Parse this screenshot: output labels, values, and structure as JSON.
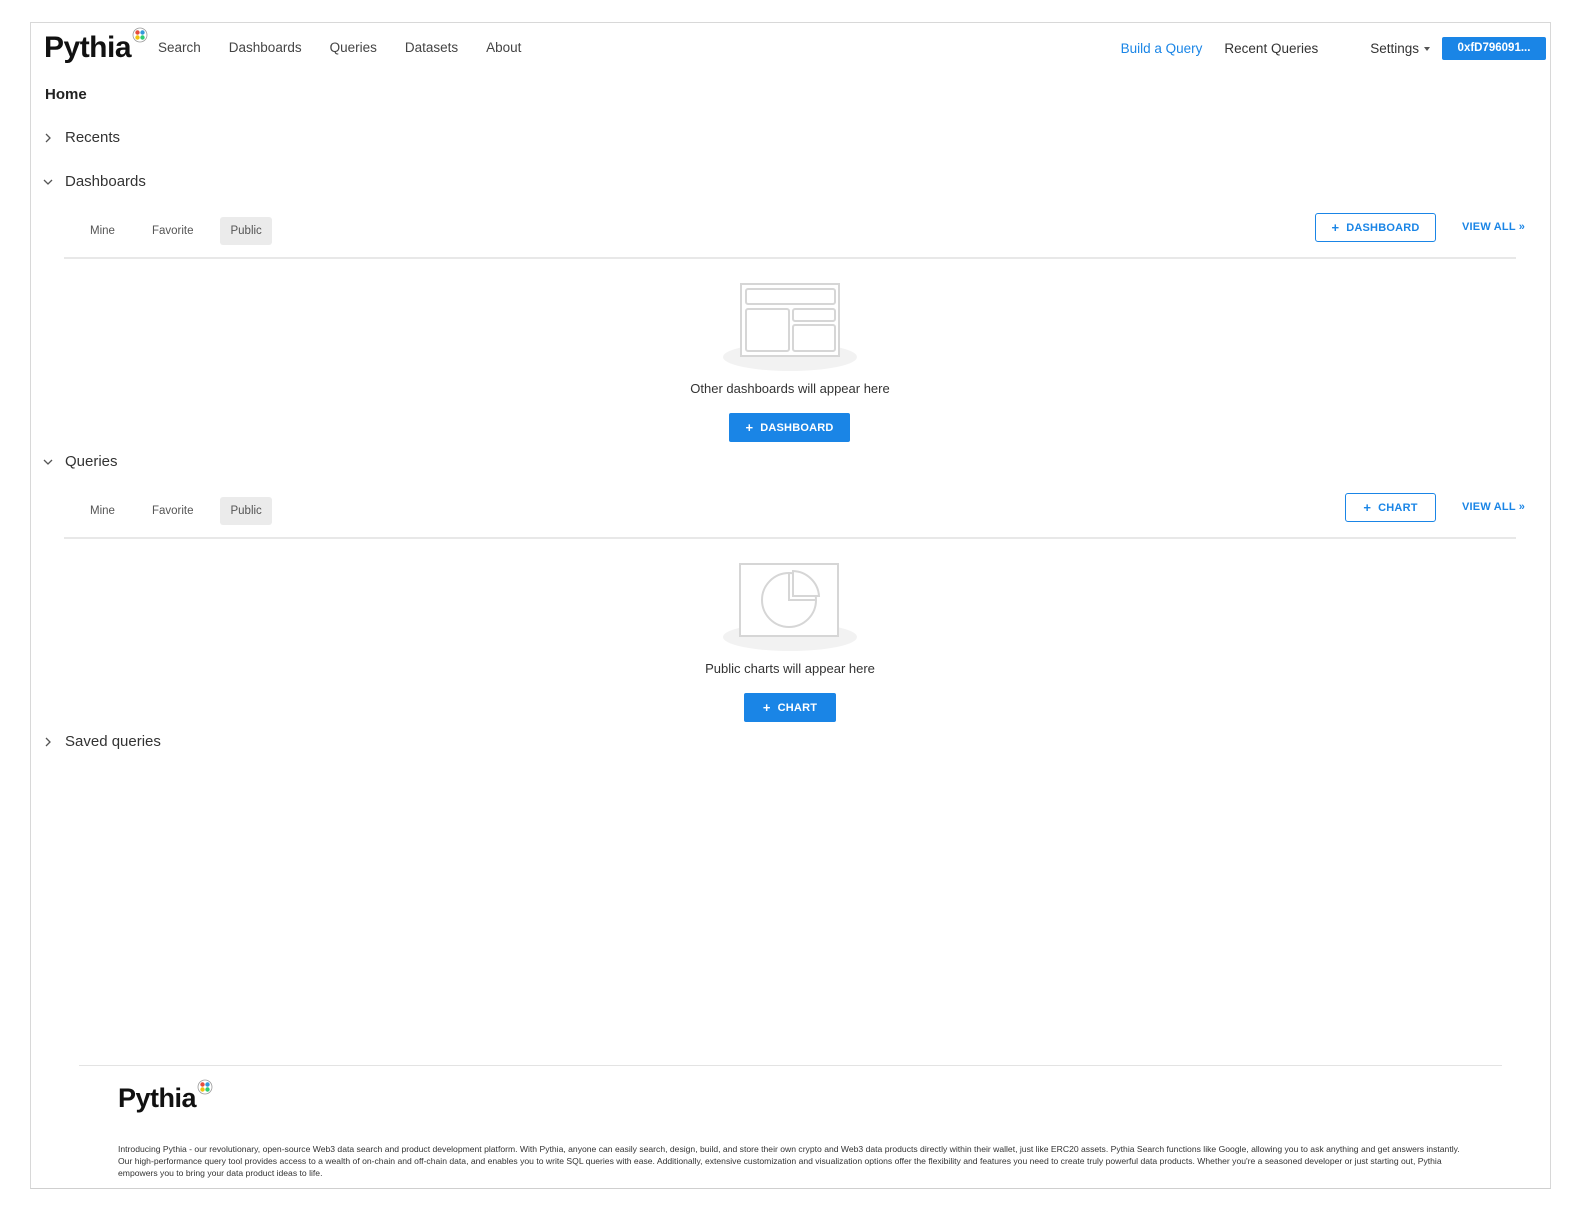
{
  "brand": {
    "name": "Pythia"
  },
  "nav": {
    "links": [
      "Search",
      "Dashboards",
      "Queries",
      "Datasets",
      "About"
    ],
    "build_query": "Build a Query",
    "recent_queries": "Recent Queries",
    "settings": "Settings",
    "wallet": "0xfD796091..."
  },
  "page": {
    "title": "Home"
  },
  "sections": {
    "recents": {
      "label": "Recents",
      "expanded": false
    },
    "dashboards": {
      "label": "Dashboards",
      "expanded": true,
      "tabs": [
        "Mine",
        "Favorite",
        "Public"
      ],
      "active_tab": "Public",
      "add_label": "DASHBOARD",
      "view_all": "VIEW ALL »",
      "empty_text": "Other dashboards will appear here",
      "empty_button": "DASHBOARD",
      "empty_icon": "dashboard-placeholder-icon"
    },
    "queries": {
      "label": "Queries",
      "expanded": true,
      "tabs": [
        "Mine",
        "Favorite",
        "Public"
      ],
      "active_tab": "Public",
      "add_label": "CHART",
      "view_all": "VIEW ALL »",
      "empty_text": "Public charts will appear here",
      "empty_button": "CHART",
      "empty_icon": "pie-chart-placeholder-icon"
    },
    "saved_queries": {
      "label": "Saved queries",
      "expanded": false
    }
  },
  "footer": {
    "brand": "Pythia",
    "description": "Introducing Pythia - our revolutionary, open-source Web3 data search and product development platform. With Pythia, anyone can easily search, design, build, and store their own crypto and Web3 data products directly within their wallet, just like ERC20 assets. Pythia Search functions like Google, allowing you to ask anything and get answers instantly. Our high-performance query tool provides access to a wealth of on-chain and off-chain data, and enables you to write SQL queries with ease. Additionally, extensive customization and visualization options offer the flexibility and features you need to create truly powerful data products. Whether you're a seasoned developer or just starting out, Pythia empowers you to bring your data product ideas to life."
  },
  "colors": {
    "accent": "#1a85e6",
    "tab_active_bg": "#ebebeb",
    "divider": "#e8e8e8"
  }
}
